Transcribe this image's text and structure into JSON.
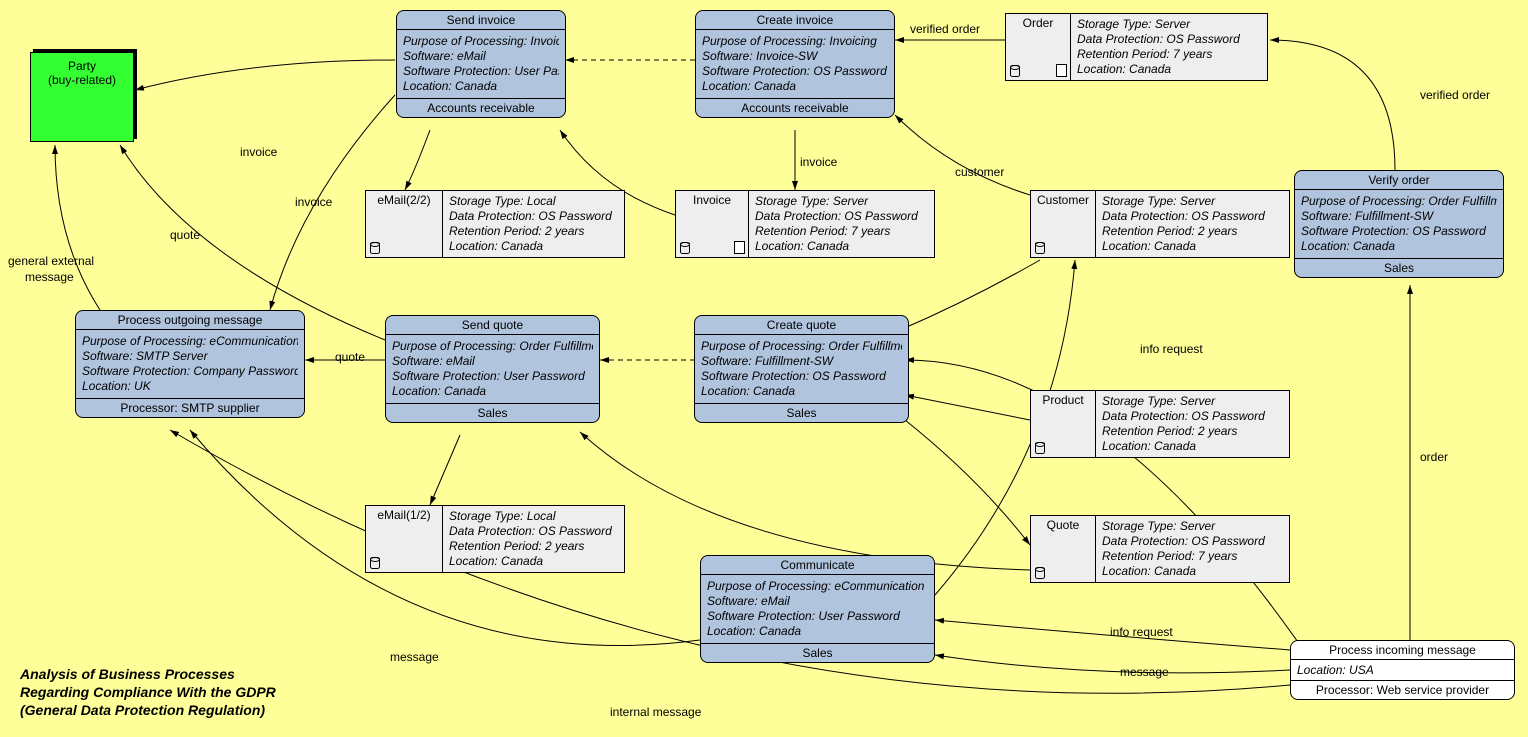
{
  "caption": {
    "l1": "Analysis of Business Processes",
    "l2": "Regarding Compliance With the GDPR",
    "l3": "(General Data Protection Regulation)"
  },
  "party": {
    "l1": "Party",
    "l2": "(buy-related)"
  },
  "proc": {
    "sendInvoice": {
      "title": "Send invoice",
      "p1": "Purpose of Processing: Invoicing",
      "p2": "Software: eMail",
      "p3": "Software Protection: User Password",
      "p4": "Location: Canada",
      "footer": "Accounts receivable"
    },
    "createInvoice": {
      "title": "Create invoice",
      "p1": "Purpose of Processing: Invoicing",
      "p2": "Software: Invoice-SW",
      "p3": "Software Protection: OS Password",
      "p4": "Location: Canada",
      "footer": "Accounts receivable"
    },
    "verifyOrder": {
      "title": "Verify order",
      "p1": "Purpose of Processing: Order Fulfillment",
      "p2": "Software: Fulfillment-SW",
      "p3": "Software Protection: OS Password",
      "p4": "Location: Canada",
      "footer": "Sales"
    },
    "pom": {
      "title": "Process outgoing message",
      "p1": "Purpose of Processing: eCommunication",
      "p2": "Software: SMTP Server",
      "p3": "Software Protection: Company Password",
      "p4": "Location: UK",
      "footer": "Processor: SMTP supplier"
    },
    "sendQuote": {
      "title": "Send quote",
      "p1": "Purpose of Processing: Order Fulfillment",
      "p2": "Software: eMail",
      "p3": "Software Protection: User Password",
      "p4": "Location: Canada",
      "footer": "Sales"
    },
    "createQuote": {
      "title": "Create quote",
      "p1": "Purpose of Processing: Order Fulfillment",
      "p2": "Software: Fulfillment-SW",
      "p3": "Software Protection: OS Password",
      "p4": "Location: Canada",
      "footer": "Sales"
    },
    "communicate": {
      "title": "Communicate",
      "p1": "Purpose of Processing: eCommunication",
      "p2": "Software: eMail",
      "p3": "Software Protection: User Password",
      "p4": "Location: Canada",
      "footer": "Sales"
    }
  },
  "ext": {
    "pim": {
      "title": "Process incoming message",
      "body": "Location: USA",
      "footer": "Processor: Web service provider"
    }
  },
  "store": {
    "order": {
      "name": "Order",
      "s1": "Storage Type: Server",
      "s2": "Data Protection: OS Password",
      "s3": "Retention Period: 7 years",
      "s4": "Location: Canada"
    },
    "email2": {
      "name": "eMail(2/2)",
      "s1": "Storage Type: Local",
      "s2": "Data Protection: OS Password",
      "s3": "Retention Period: 2 years",
      "s4": "Location: Canada"
    },
    "invoice": {
      "name": "Invoice",
      "s1": "Storage Type: Server",
      "s2": "Data Protection: OS Password",
      "s3": "Retention Period: 7 years",
      "s4": "Location: Canada"
    },
    "customer": {
      "name": "Customer",
      "s1": "Storage Type: Server",
      "s2": "Data Protection: OS Password",
      "s3": "Retention Period: 2 years",
      "s4": "Location: Canada"
    },
    "product": {
      "name": "Product",
      "s1": "Storage Type: Server",
      "s2": "Data Protection: OS Password",
      "s3": "Retention Period: 2 years",
      "s4": "Location: Canada"
    },
    "email1": {
      "name": "eMail(1/2)",
      "s1": "Storage Type: Local",
      "s2": "Data Protection: OS Password",
      "s3": "Retention Period: 2 years",
      "s4": "Location: Canada"
    },
    "quote": {
      "name": "Quote",
      "s1": "Storage Type: Server",
      "s2": "Data Protection: OS Password",
      "s3": "Retention Period: 7 years",
      "s4": "Location: Canada"
    }
  },
  "edge": {
    "verifiedOrder": "verified order",
    "invoice": "invoice",
    "customer": "customer",
    "quote": "quote",
    "message": "message",
    "infoRequest": "info request",
    "order": "order",
    "internalMessage": "internal message",
    "generalExternalMessage1": "general external",
    "generalExternalMessage2": "message"
  }
}
